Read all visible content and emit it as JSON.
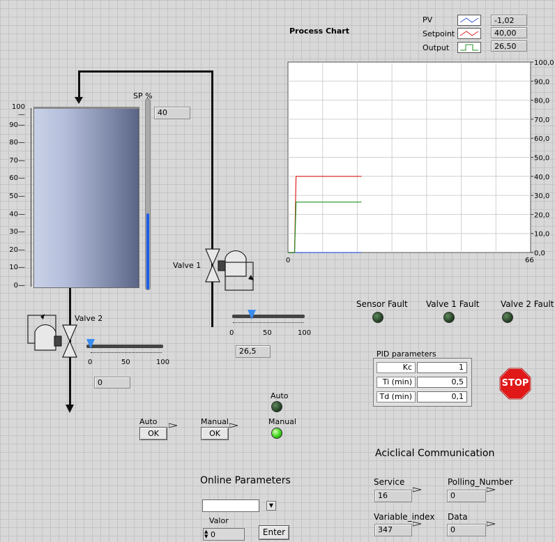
{
  "chart": {
    "title": "Process Chart",
    "legend": [
      {
        "name": "PV",
        "value": "-1,02",
        "color": "#3a5ad6"
      },
      {
        "name": "Setpoint",
        "value": "40,00",
        "color": "#e02020"
      },
      {
        "name": "Output",
        "value": "26,50",
        "color": "#209020"
      }
    ],
    "x_ticks": [
      "0",
      "66"
    ],
    "y_ticks": [
      "100,0",
      "90,0",
      "80,0",
      "70,0",
      "60,0",
      "50,0",
      "40,0",
      "30,0",
      "20,0",
      "10,0",
      "0,0"
    ]
  },
  "chart_data": {
    "type": "line",
    "title": "Process Chart",
    "xlim": [
      0,
      66
    ],
    "ylim": [
      0,
      100
    ],
    "grid": true,
    "legend_position": "top-right",
    "series": [
      {
        "name": "PV",
        "color": "#3a5ad6",
        "points": [
          [
            0,
            0
          ],
          [
            20,
            0
          ]
        ]
      },
      {
        "name": "Setpoint",
        "color": "#e02020",
        "points": [
          [
            0,
            0
          ],
          [
            1.8,
            0
          ],
          [
            2.2,
            40
          ],
          [
            20,
            40
          ]
        ]
      },
      {
        "name": "Output",
        "color": "#209020",
        "points": [
          [
            0,
            0
          ],
          [
            1.8,
            0
          ],
          [
            2.2,
            26.5
          ],
          [
            20,
            26.5
          ]
        ]
      }
    ]
  },
  "tank": {
    "scale": [
      "100",
      "90",
      "80",
      "70",
      "60",
      "50",
      "40",
      "30",
      "20",
      "10",
      "0"
    ],
    "level_percent": 0,
    "sp_label": "SP %",
    "sp_value": "40",
    "sp_percent": 40
  },
  "valve1": {
    "label": "Valve 1",
    "scale": [
      "0",
      "50",
      "100"
    ],
    "value": "26,5",
    "percent": 26.5
  },
  "valve2": {
    "label": "Valve 2",
    "scale": [
      "0",
      "50",
      "100"
    ],
    "value": "0",
    "percent": 0
  },
  "faults": [
    {
      "label": "Sensor Fault",
      "on": false
    },
    {
      "label": "Valve 1 Fault",
      "on": false
    },
    {
      "label": "Valve 2 Fault",
      "on": false
    }
  ],
  "pid": {
    "title": "PID parameters",
    "rows": [
      {
        "label": "Kc",
        "value": "1"
      },
      {
        "label": "Ti (min)",
        "value": "0,5"
      },
      {
        "label": "Td (min)",
        "value": "0,1"
      }
    ]
  },
  "stop_label": "STOP",
  "mode": {
    "auto_btn_label": "Auto",
    "manual_btn_label": "Manual",
    "ok": "OK",
    "auto_led_label": "Auto",
    "manual_led_label": "Manual",
    "auto_on": false,
    "manual_on": true
  },
  "online": {
    "title": "Online Parameters",
    "select_value": "",
    "valor_label": "Valor",
    "valor_value": "0",
    "enter_label": "Enter"
  },
  "acyclic": {
    "title": "Aciclical Communication",
    "service_label": "Service",
    "service_value": "16",
    "polling_label": "Polling_Number",
    "polling_value": "0",
    "varidx_label": "Variable_index",
    "varidx_value": "347",
    "data_label": "Data",
    "data_value": "0"
  }
}
